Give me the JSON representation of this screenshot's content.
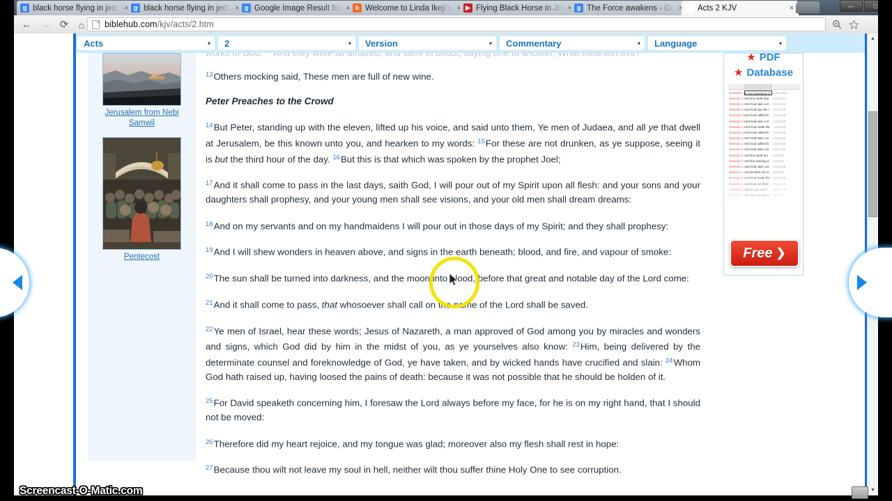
{
  "browser": {
    "tabs": [
      {
        "title": "black horse flying in jed",
        "favicon": "google-icon",
        "favicon_glyph": "g",
        "active": false
      },
      {
        "title": "black horse flying in jed",
        "favicon": "google-icon",
        "favicon_glyph": "g",
        "active": false
      },
      {
        "title": "Google Image Result for",
        "favicon": "google-icon",
        "favicon_glyph": "g",
        "active": false
      },
      {
        "title": "Welcome to Linda Ikeji's",
        "favicon": "blogger-icon",
        "favicon_glyph": "b",
        "active": false
      },
      {
        "title": "Flying Black Horse in Jer",
        "favicon": "youtube-icon",
        "favicon_glyph": "▶",
        "active": false
      },
      {
        "title": "The Force awakens - Goo",
        "favicon": "google-icon",
        "favicon_glyph": "g",
        "active": false
      },
      {
        "title": "Acts 2 KJV",
        "favicon": "cross-icon",
        "favicon_glyph": "✝",
        "active": true
      }
    ],
    "tab_close_label": "×",
    "window_controls": {
      "minimize": "—",
      "maximize": "□",
      "close": "✕"
    },
    "toolbar": {
      "back_label": "←",
      "forward_label": "→",
      "reload_label": "⟳",
      "home_label": "⌂",
      "url_domain": "biblehub.com",
      "url_path": "/kjv/acts/2.htm",
      "zoom_icon": "magnifier-icon",
      "bookmark_icon": "star-outline-icon",
      "menu_icon": "hamburger-menu-icon"
    }
  },
  "selectbar": [
    {
      "label": "Acts",
      "name": "book-select"
    },
    {
      "label": "2",
      "name": "chapter-select"
    },
    {
      "label": "Version",
      "name": "version-select"
    },
    {
      "label": "Commentary",
      "name": "commentary-select"
    },
    {
      "label": "Language",
      "name": "language-select"
    }
  ],
  "caret": "▾",
  "sidebar": {
    "images": [
      {
        "caption": "Jerusalem from Nebi Samwil",
        "name": "jerusalem-thumbnail"
      },
      {
        "caption": "Pentecost",
        "name": "pentecost-thumbnail"
      }
    ]
  },
  "ad": {
    "line1": "PDF",
    "line2": "Database",
    "star_glyph": "★",
    "button_label": "Free",
    "button_chevron": "❯",
    "sheet_rows": [
      {
        "ref": "Genesis 1:1",
        "kjv": "In the beginning G",
        "other": "In the beg"
      },
      {
        "ref": "Genesis 1:2",
        "kjv": "And the earth was",
        "other": "And the e"
      },
      {
        "ref": "Genesis 1:3",
        "kjv": "And God said, Let",
        "other": "And God"
      },
      {
        "ref": "Genesis 1:4",
        "kjv": "And God saw the l",
        "other": "And God"
      },
      {
        "ref": "Genesis 1:5",
        "kjv": "And God called th",
        "other": "And God"
      },
      {
        "ref": "Genesis 1:6",
        "kjv": "And God said, Let",
        "other": "And God"
      },
      {
        "ref": "Genesis 1:7",
        "kjv": "And God made the",
        "other": "And God"
      },
      {
        "ref": "Genesis 1:8",
        "kjv": "And God called th",
        "other": "And God"
      },
      {
        "ref": "Genesis 1:9",
        "kjv": "And God said, Let",
        "other": "And God"
      },
      {
        "ref": "Genesis 1:10",
        "kjv": "And God called th",
        "other": "And God"
      },
      {
        "ref": "Genesis 1:11",
        "kjv": "And God said, Let",
        "other": "And God"
      },
      {
        "ref": "Genesis 1:12",
        "kjv": "And the earth bro",
        "other": "And the"
      },
      {
        "ref": "Genesis 1:13",
        "kjv": "And the evening a",
        "other": "And the"
      },
      {
        "ref": "Genesis 1:14",
        "kjv": "And God said, Let",
        "other": "And God"
      },
      {
        "ref": "Genesis 1:15",
        "kjv": "And let them be fo",
        "other": "and let t"
      },
      {
        "ref": "Genesis 1:16",
        "kjv": "And God made the",
        "other": "And God"
      },
      {
        "ref": "Genesis 1:17",
        "kjv": "And God set them",
        "other": "And God"
      },
      {
        "ref": "Genesis 1:18",
        "kjv": "And to rule over t",
        "other": "and to ru"
      },
      {
        "ref": "Genesis 1:19",
        "kjv": "And the evening a",
        "other": "And the"
      }
    ]
  },
  "scripture": {
    "clipped_top": "works of God. ¹²And they were all amazed, and were in doubt, saying one to another, What meaneth this?",
    "section_heading": "Peter Preaches to the Crowd",
    "verses": [
      {
        "num": "13",
        "text": "Others mocking said, These men are full of new wine."
      },
      {
        "num": "14",
        "text": "But Peter, standing up with the eleven, lifted up his voice, and said unto them, Ye men of Judaea, and all "
      },
      {
        "num": "15",
        "text": "For these are not drunken, as ye suppose, seeing it is "
      },
      {
        "num": "16",
        "text": "But this is that which was spoken by the prophet Joel;"
      },
      {
        "num": "17",
        "text": "And it shall come to pass in the last days, saith God, I will pour out of my Spirit upon all flesh: and your sons and your daughters shall prophesy, and your young men shall see visions, and your old men shall dream dreams:"
      },
      {
        "num": "18",
        "text": "And on my servants and on my handmaidens I will pour out in those days of my Spirit; and they shall prophesy:"
      },
      {
        "num": "19",
        "text": "And I will shew wonders in heaven above, and signs in the earth beneath; blood, and fire, and vapour of smoke:"
      },
      {
        "num": "20",
        "text": "The sun shall be turned into darkness, and the moon into blood, before that great and notable day of the Lord come:"
      },
      {
        "num": "21",
        "text": "And it shall come to pass, "
      },
      {
        "num": "22",
        "text": "Ye men of Israel, hear these words; Jesus of Nazareth, a man approved of God among you by miracles and wonders and signs, which God did by him in the midst of you, as ye yourselves also know:"
      },
      {
        "num": "23",
        "text": "Him, being delivered by the determinate counsel and foreknowledge of God, ye have taken, and by wicked hands have crucified and slain:"
      },
      {
        "num": "24",
        "text": "Whom God hath raised up, having loosed the pains of death: because it was not possible that he should be holden of it."
      },
      {
        "num": "25",
        "text": "For David speaketh concerning him, I foresaw the Lord always before my face, for he is on my right hand, that I should not be moved:"
      },
      {
        "num": "26",
        "text": "Therefore did my heart rejoice, and my tongue was glad; moreover also my flesh shall rest in hope:"
      },
      {
        "num": "27",
        "text": "Because thou wilt not leave my soul in hell, neither wilt thou suffer thine Holy One to see corruption."
      }
    ],
    "italics": {
      "v14_ye": "ye",
      "v14_tail": "that dwell at Jerusalem, be this known unto you, and hearken to my words: ",
      "v15_but": "but",
      "v15_tail": " the third hour of the day. ",
      "v21_that": "that",
      "v21_tail": " whosoever shall call on the name of the Lord shall be saved."
    }
  },
  "page_nav": {
    "prev_label": "previous-chapter-arrow",
    "next_label": "next-chapter-arrow"
  },
  "watermark": "Screencast-O-Matic.com",
  "colors": {
    "link_blue": "#2b6fb5",
    "select_blue": "#1a73c4",
    "frame_blue": "#1b6fd4",
    "bar_blue": "#ccecfb",
    "verse_num": "#2f7fc6",
    "ad_red": "#e8231f",
    "highlight_yellow": "#f2e30f"
  }
}
